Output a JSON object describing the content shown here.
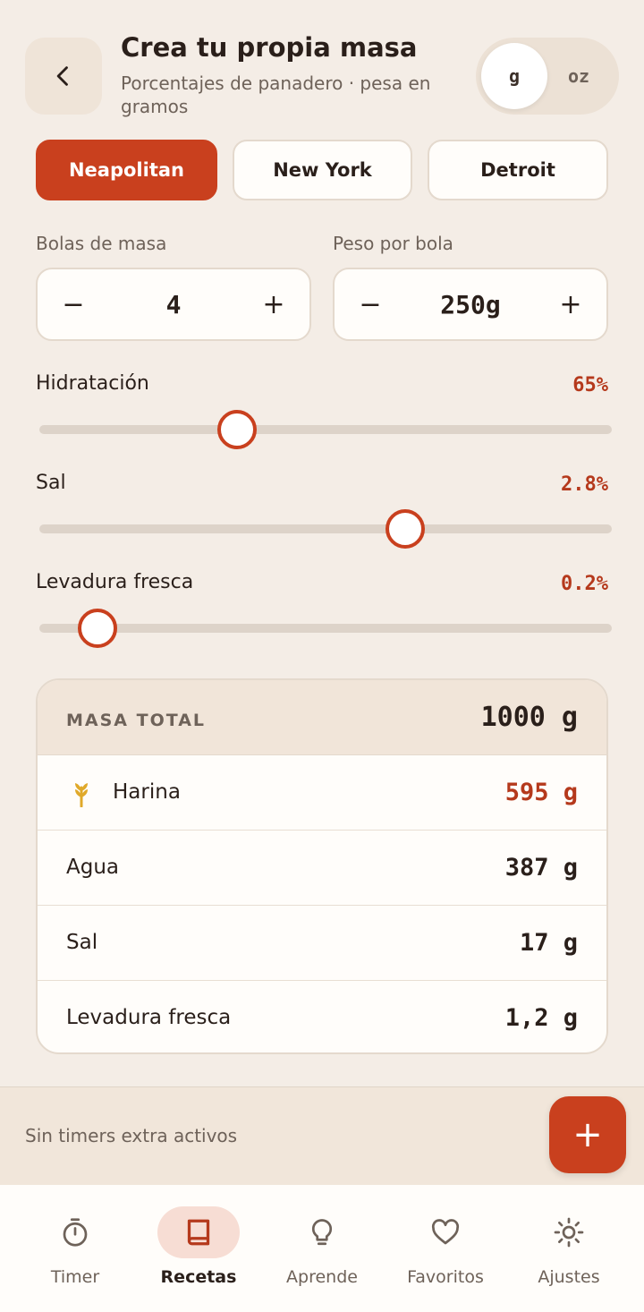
{
  "header": {
    "title": "Crea tu propia masa",
    "subtitle": "Porcentajes de panadero · pesa en gramos",
    "back_icon": "chevron-left-icon",
    "units": {
      "active": "g",
      "inactive": "oz"
    }
  },
  "styles": [
    "Neapolitan",
    "New York",
    "Detroit"
  ],
  "active_style": "Neapolitan",
  "steppers": {
    "balls": {
      "label": "Bolas de masa",
      "value": "4",
      "minus": "−",
      "plus": "+"
    },
    "weight": {
      "label": "Peso por bola",
      "value": "250g",
      "minus": "−",
      "plus": "+"
    }
  },
  "sliders": [
    {
      "label": "Hidratación",
      "value": "65%",
      "fraction": 0.345
    },
    {
      "label": "Sal",
      "value": "2.8%",
      "fraction": 0.639
    },
    {
      "label": "Levadura fresca",
      "value": "0.2%",
      "fraction": 0.101
    }
  ],
  "result": {
    "header_label": "MASA TOTAL",
    "total": "1000 g",
    "rows": [
      {
        "label": "Harina",
        "value": "595 g",
        "icon": "wheat-icon"
      },
      {
        "label": "Agua",
        "value": "387 g"
      },
      {
        "label": "Sal",
        "value": "17 g"
      },
      {
        "label": "Levadura fresca",
        "value": "1,2 g"
      }
    ]
  },
  "timers": {
    "text": "Sin timers extra activos",
    "add_label": "+"
  },
  "nav": {
    "items": [
      {
        "label": "Timer",
        "icon": "stopwatch-icon"
      },
      {
        "label": "Recetas",
        "icon": "book-icon",
        "active": true
      },
      {
        "label": "Aprende",
        "icon": "lightbulb-icon"
      },
      {
        "label": "Favoritos",
        "icon": "heart-icon"
      },
      {
        "label": "Ajustes",
        "icon": "sun-icon"
      }
    ]
  },
  "colors": {
    "accent": "#c9401e",
    "accent_text": "#b5391c",
    "background": "#f4ede6"
  }
}
